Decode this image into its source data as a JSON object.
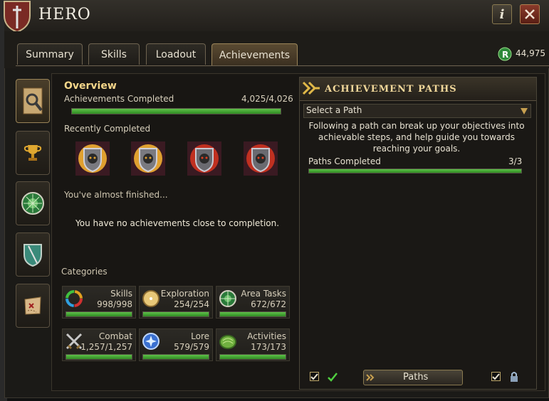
{
  "window": {
    "title": "HERO"
  },
  "tabs": [
    {
      "label": "Summary"
    },
    {
      "label": "Skills"
    },
    {
      "label": "Loadout"
    },
    {
      "label": "Achievements",
      "active": true
    }
  ],
  "currency": {
    "icon": "runecoin-icon",
    "amount": "44,975"
  },
  "overview": {
    "title": "Overview",
    "completed_label": "Achievements Completed",
    "completed_value": "4,025/4,026",
    "completed_fraction": 0.9998,
    "recent_label": "Recently Completed",
    "recent_badges": [
      "achievement-badge-icon",
      "achievement-badge-icon",
      "achievement-badge-icon",
      "achievement-badge-icon"
    ],
    "almost_label": "You've almost finished...",
    "no_achievements": "You have no achievements close to completion."
  },
  "categories": {
    "title": "Categories",
    "items": [
      {
        "name": "Skills",
        "value": "998/998",
        "icon": "skills-wheel-icon",
        "fraction": 1
      },
      {
        "name": "Exploration",
        "value": "254/254",
        "icon": "compass-icon",
        "fraction": 1
      },
      {
        "name": "Area Tasks",
        "value": "672/672",
        "icon": "area-tasks-icon",
        "fraction": 1
      },
      {
        "name": "Combat",
        "value": "1,257/1,257",
        "icon": "crossed-swords-icon",
        "fraction": 1
      },
      {
        "name": "Lore",
        "value": "579/579",
        "icon": "lore-orb-icon",
        "fraction": 1
      },
      {
        "name": "Activities",
        "value": "173/173",
        "icon": "activities-icon",
        "fraction": 1
      }
    ]
  },
  "side_nav": [
    {
      "icon": "magnifier-scroll-icon",
      "active": true
    },
    {
      "icon": "trophy-icon"
    },
    {
      "icon": "green-medallion-icon"
    },
    {
      "icon": "shield-sword-icon"
    },
    {
      "icon": "treasure-map-icon"
    }
  ],
  "paths": {
    "title": "ACHIEVEMENT PATHS",
    "select_value": "Select a Path",
    "description": "Following a path can break up your objectives into achievable steps, and help guide you towards reaching your goals.",
    "completed_label": "Paths Completed",
    "completed_value": "3/3",
    "completed_fraction": 1,
    "button_label": "Paths"
  },
  "colors": {
    "accent": "#f4d68a",
    "progress": "#4caf38",
    "close": "#8a3a2a"
  }
}
